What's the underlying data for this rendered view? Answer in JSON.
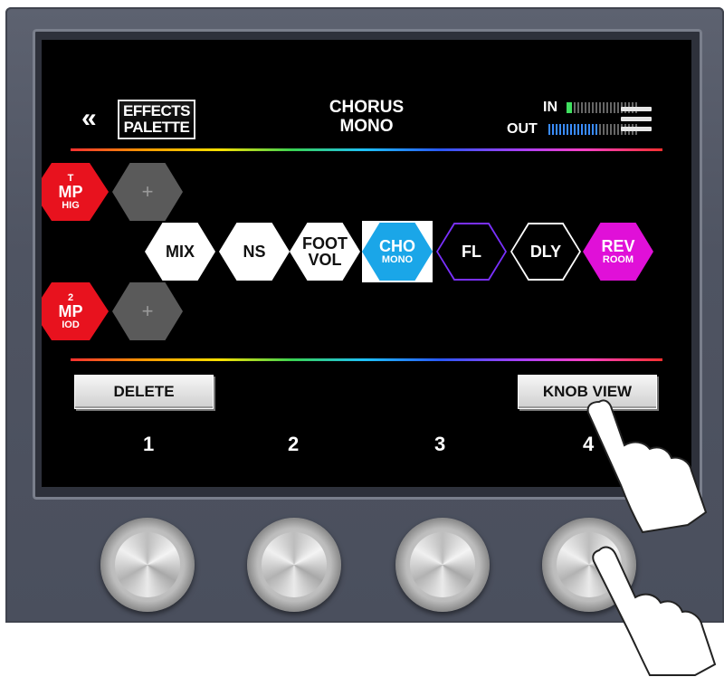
{
  "header": {
    "back_glyph": "«",
    "palette_label_line1": "EFFECTS",
    "palette_label_line2": "PALETTE",
    "effect_title_line1": "CHORUS",
    "effect_title_line2": "MONO",
    "in_label": "IN",
    "out_label": "OUT",
    "in_level": 0.08,
    "out_level": 0.55,
    "in_color": "#40e060",
    "out_color": "#3a8cff"
  },
  "chain": {
    "top_row": [
      {
        "lines": [
          "T",
          "MP",
          "HIG"
        ],
        "color": "#e8121e"
      },
      {
        "label": "+",
        "color": "#5a5a5a"
      }
    ],
    "middle_row": [
      {
        "label": "MIX",
        "sub": "",
        "style": "white"
      },
      {
        "label": "NS",
        "sub": "",
        "style": "white"
      },
      {
        "label": "FOOT",
        "sub": "VOL",
        "style": "white"
      },
      {
        "label": "CHO",
        "sub": "MONO",
        "style": "blue"
      },
      {
        "label": "FL",
        "sub": "",
        "style": "purple-outline"
      },
      {
        "label": "DLY",
        "sub": "",
        "style": "white-outline"
      },
      {
        "label": "REV",
        "sub": "ROOM",
        "style": "magenta"
      }
    ],
    "bottom_row": [
      {
        "lines": [
          "2",
          "MP",
          "IOD"
        ],
        "color": "#e8121e"
      },
      {
        "label": "+",
        "color": "#5a5a5a"
      }
    ]
  },
  "buttons": {
    "delete_label": "DELETE",
    "knob_view_label": "KNOB VIEW"
  },
  "knob_numbers": [
    "1",
    "2",
    "3",
    "4"
  ],
  "colors": {
    "accent_blue": "#1aa6e8",
    "magenta": "#e010d8",
    "purple": "#7a30ff",
    "red": "#e8121e"
  }
}
